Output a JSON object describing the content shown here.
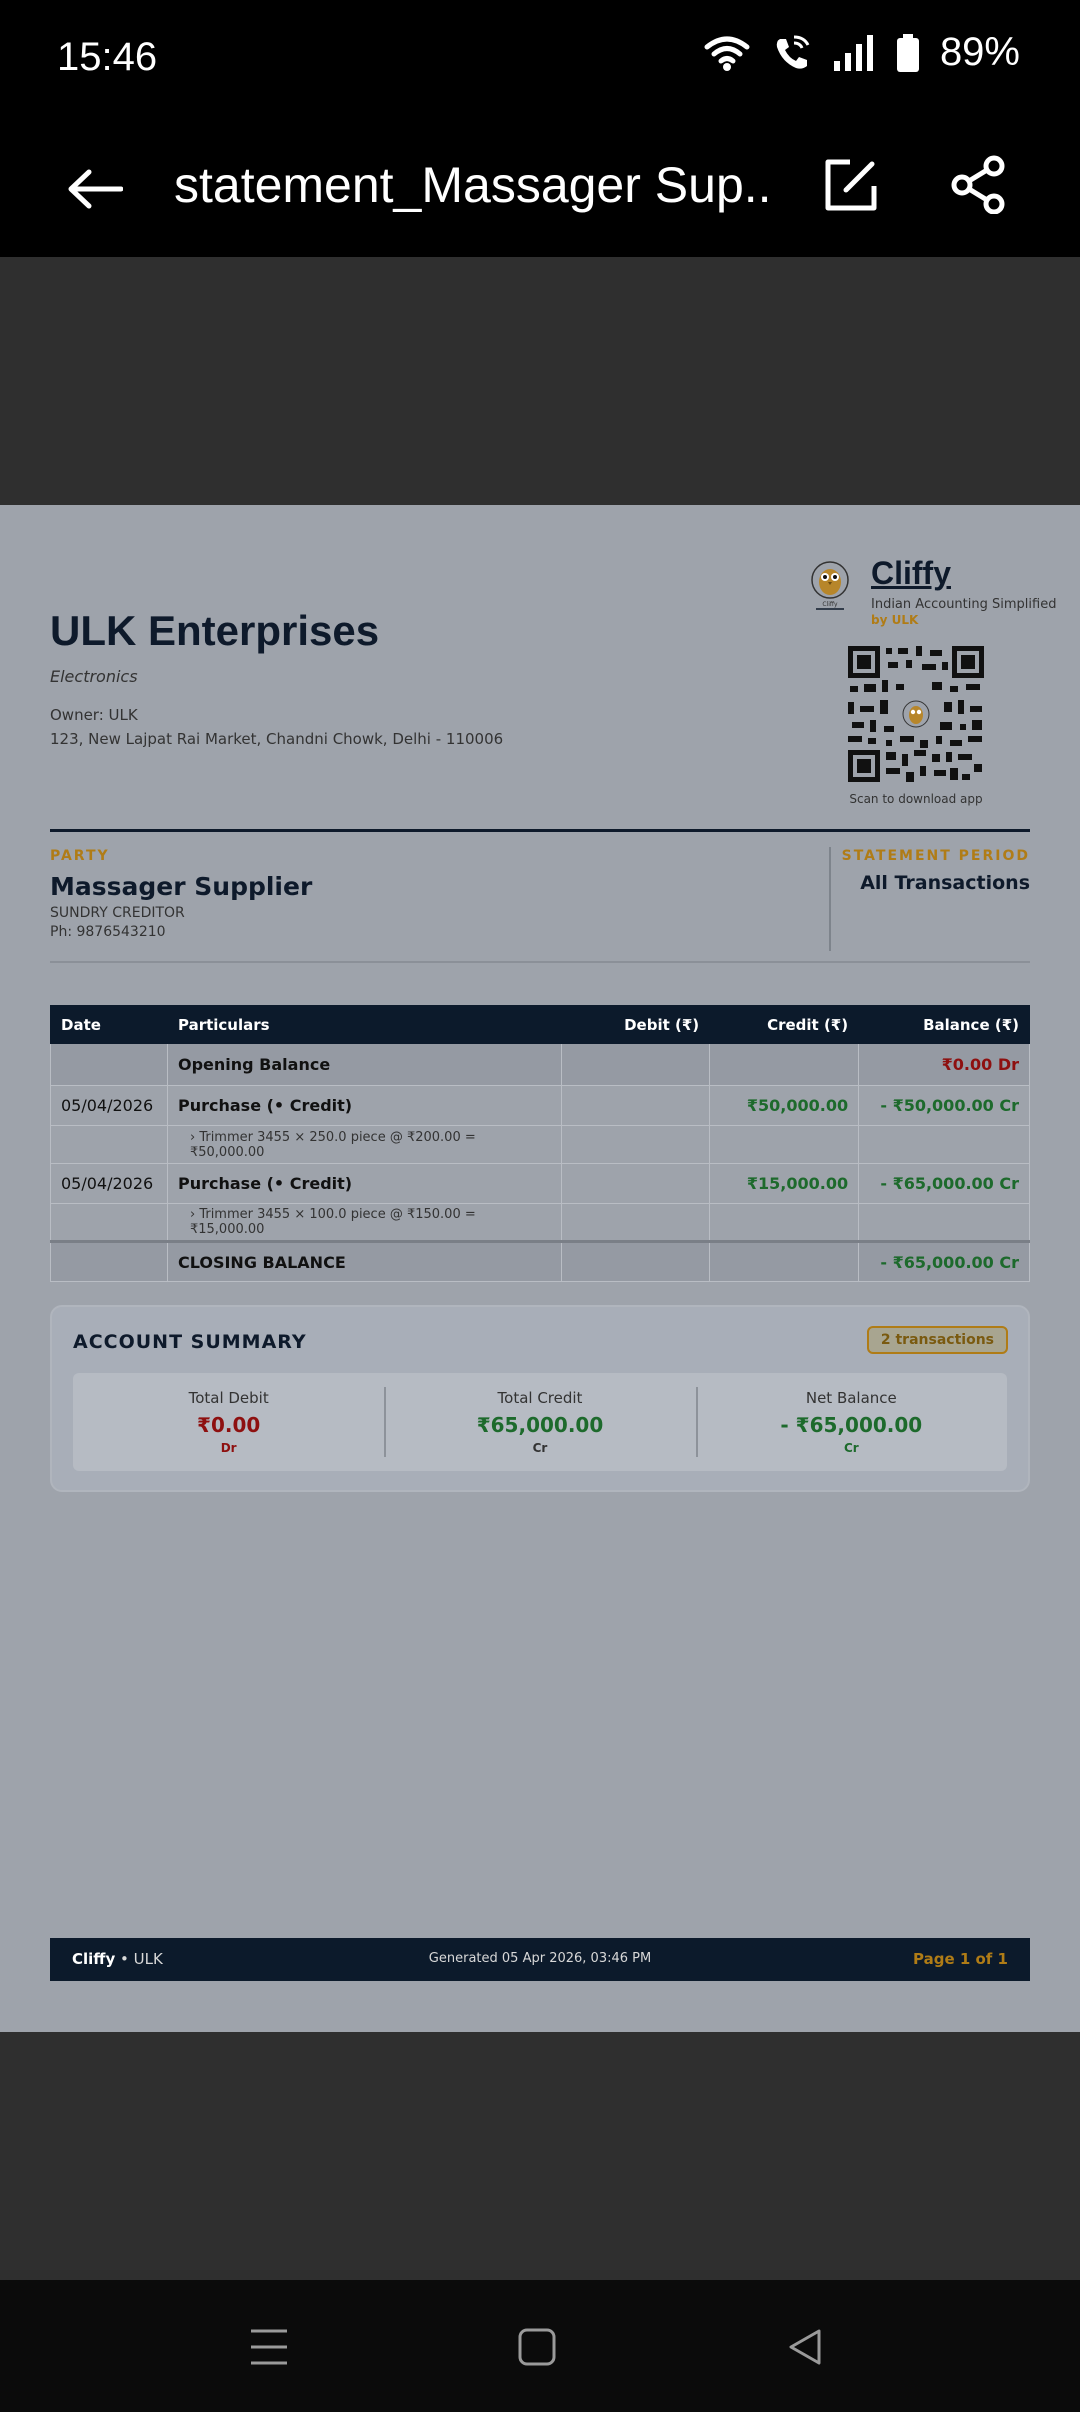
{
  "status": {
    "time": "15:46",
    "battery": "89%"
  },
  "header": {
    "title": "statement_Massager Sup..."
  },
  "doc": {
    "company": "ULK Enterprises",
    "category": "Electronics",
    "owner": "Owner: ULK",
    "address": "123, New Lajpat Rai Market, Chandni Chowk, Delhi - 110006",
    "brand": "Cliffy",
    "tagline": "Indian Accounting Simplified",
    "by": "by ULK",
    "logo_text": "Cliffy",
    "qr_caption": "Scan to download app",
    "party_label": "PARTY",
    "party_name": "Massager Supplier",
    "party_type": "SUNDRY CREDITOR",
    "party_phone": "Ph: 9876543210",
    "period_label": "STATEMENT PERIOD",
    "period_value": "All Transactions",
    "table": {
      "headers": [
        "Date",
        "Particulars",
        "Debit (₹)",
        "Credit (₹)",
        "Balance (₹)"
      ],
      "opening": {
        "label": "Opening Balance",
        "balance": "₹0.00 Dr"
      },
      "rows": [
        {
          "date": "05/04/2026",
          "particulars": "Purchase  (• Credit)",
          "debit": "",
          "credit": "₹50,000.00",
          "balance": "- ₹50,000.00 Cr",
          "detail": "› Trimmer 3455  × 250.0 piece  @  ₹200.00  =  ₹50,000.00"
        },
        {
          "date": "05/04/2026",
          "particulars": "Purchase  (• Credit)",
          "debit": "",
          "credit": "₹15,000.00",
          "balance": "- ₹65,000.00 Cr",
          "detail": "› Trimmer 3455  × 100.0 piece  @  ₹150.00  =  ₹15,000.00"
        }
      ],
      "closing": {
        "label": "CLOSING BALANCE",
        "balance": "- ₹65,000.00 Cr"
      }
    },
    "summary": {
      "title": "ACCOUNT SUMMARY",
      "badge": "2 transactions",
      "total_debit_label": "Total Debit",
      "total_debit": "₹0.00",
      "total_debit_sub": "Dr",
      "total_credit_label": "Total Credit",
      "total_credit": "₹65,000.00",
      "total_credit_sub": "Cr",
      "net_label": "Net Balance",
      "net": "- ₹65,000.00",
      "net_sub": "Cr"
    },
    "footer": {
      "brand": "Cliffy",
      "owner": " • ULK",
      "generated": "Generated 05 Apr 2026, 03:46 PM",
      "page": "Page 1 of 1"
    }
  },
  "colors": {
    "navy": "#0c1a2b",
    "gold": "#b07c16",
    "green": "#1d6a2c",
    "red": "#8e1010"
  },
  "icons": [
    "back-arrow-icon",
    "edit-icon",
    "share-icon",
    "wifi-icon",
    "wifi-call-icon",
    "signal-icon",
    "battery-icon",
    "recents-icon",
    "home-icon",
    "nav-back-icon"
  ]
}
